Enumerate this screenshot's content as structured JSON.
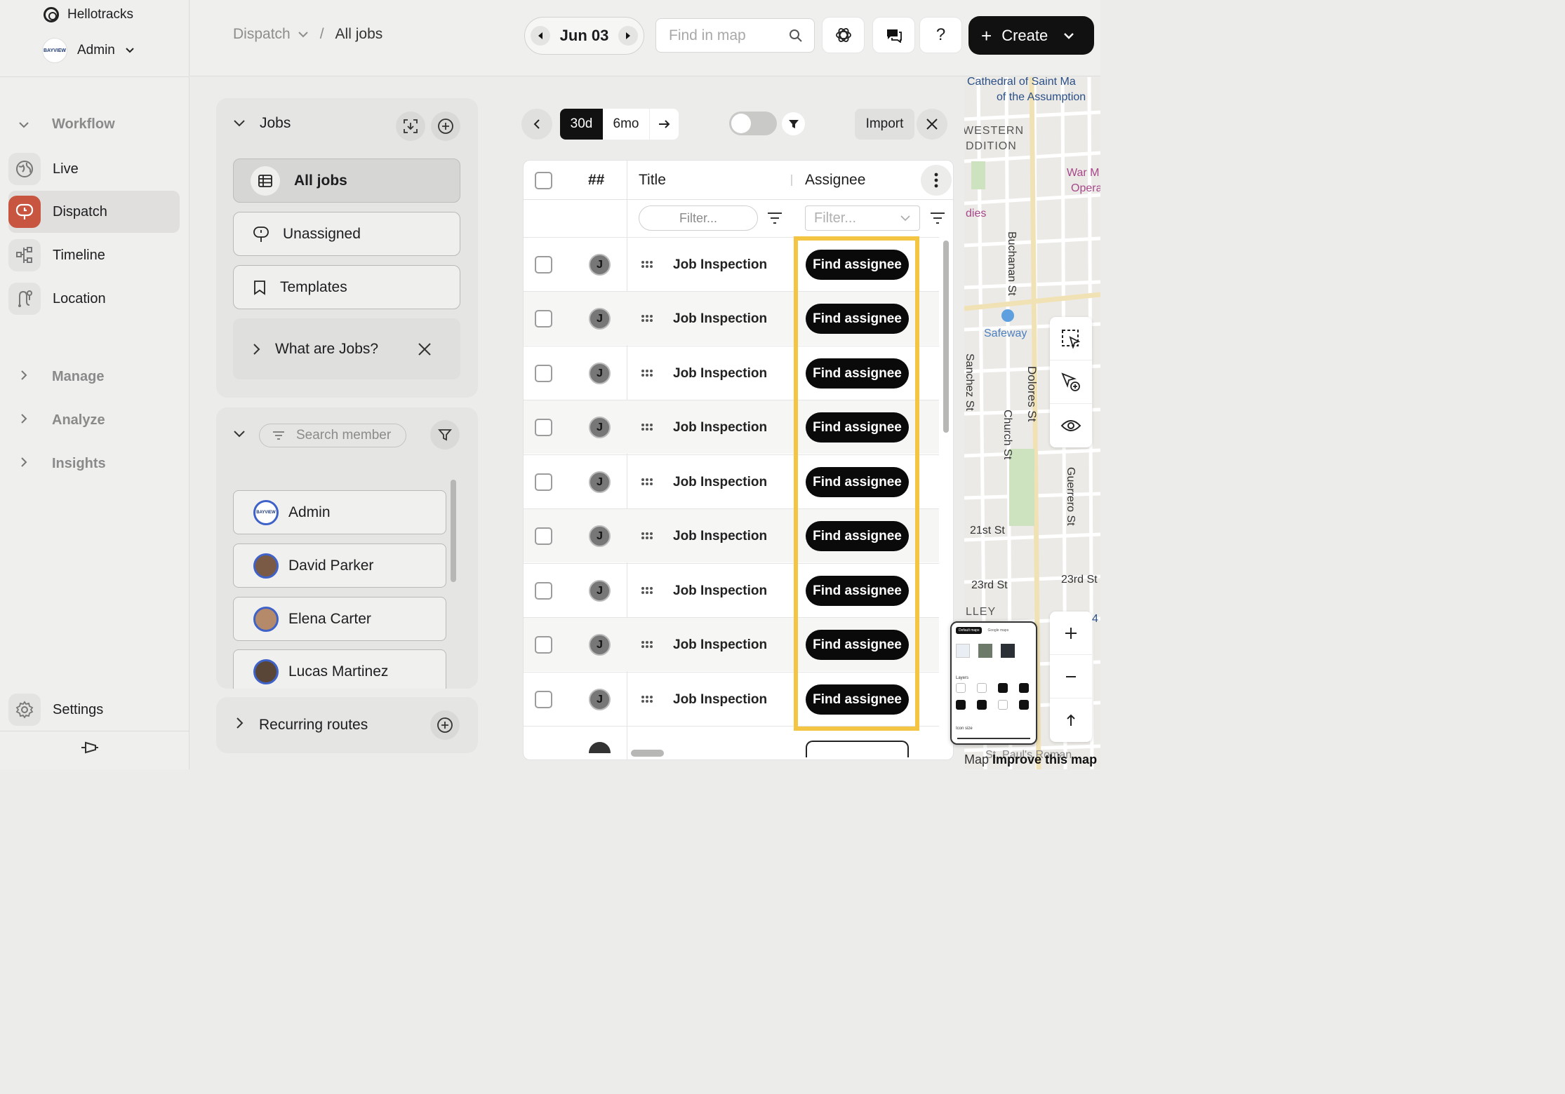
{
  "sidebar": {
    "org_name": "Hellotracks",
    "account_name": "Admin",
    "avatar_text": "BAYVIEW",
    "sections": {
      "workflow": "Workflow",
      "manage": "Manage",
      "analyze": "Analyze",
      "insights": "Insights"
    },
    "items": [
      {
        "label": "Live",
        "icon": "globe-icon"
      },
      {
        "label": "Dispatch",
        "icon": "dispatch-icon",
        "active": true
      },
      {
        "label": "Timeline",
        "icon": "timeline-icon"
      },
      {
        "label": "Location",
        "icon": "route-icon"
      }
    ],
    "settings_label": "Settings"
  },
  "header": {
    "breadcrumb_parent": "Dispatch",
    "breadcrumb_separator": "/",
    "breadcrumb_current": "All jobs",
    "date": "Jun 03",
    "map_search_placeholder": "Find in map",
    "help_label": "?",
    "create_label": "Create"
  },
  "jobs_panel": {
    "title": "Jobs",
    "items": [
      "All jobs",
      "Unassigned",
      "Templates"
    ],
    "info_label": "What are Jobs?"
  },
  "members_panel": {
    "search_placeholder": "Search member",
    "members": [
      {
        "name": "Admin"
      },
      {
        "name": "David Parker"
      },
      {
        "name": "Elena Carter"
      },
      {
        "name": "Lucas Martinez"
      }
    ]
  },
  "recurring": {
    "label": "Recurring routes"
  },
  "toolbar": {
    "range_options": [
      "30d",
      "6mo"
    ],
    "selected_range": "30d",
    "import_label": "Import"
  },
  "table": {
    "headers": {
      "number": "##",
      "title": "Title",
      "assignee": "Assignee"
    },
    "title_filter_placeholder": "Filter...",
    "assignee_filter_placeholder": "Filter...",
    "rows": [
      {
        "badge": "J",
        "title": "Job Inspection",
        "action": "Find assignee"
      },
      {
        "badge": "J",
        "title": "Job Inspection",
        "action": "Find assignee"
      },
      {
        "badge": "J",
        "title": "Job Inspection",
        "action": "Find assignee"
      },
      {
        "badge": "J",
        "title": "Job Inspection",
        "action": "Find assignee"
      },
      {
        "badge": "J",
        "title": "Job Inspection",
        "action": "Find assignee"
      },
      {
        "badge": "J",
        "title": "Job Inspection",
        "action": "Find assignee"
      },
      {
        "badge": "J",
        "title": "Job Inspection",
        "action": "Find assignee"
      },
      {
        "badge": "J",
        "title": "Job Inspection",
        "action": "Find assignee"
      },
      {
        "badge": "J",
        "title": "Job Inspection",
        "action": "Find assignee"
      }
    ],
    "highlight_color": "#f4c542"
  },
  "map": {
    "labels": {
      "cathedral": "Cathedral of Saint Ma",
      "assumption": "of the Assumption",
      "western": "WESTERN",
      "addition": "DDITION",
      "war": "War M",
      "opera": "Opera",
      "dies": "dies",
      "buchanan": "Buchanan St",
      "safeway": "Safeway",
      "sanchez": "Sanchez St",
      "dolores": "Dolores St",
      "church": "Church St",
      "guerrero": "Guerrero St",
      "st21": "21st St",
      "st23a": "23rd St",
      "st23b": "23rd St",
      "valley": "LLEY",
      "stpaul": "St. Paul's Roman",
      "c4": "4"
    },
    "attribution_prefix": "Map",
    "attribution_link": "Improve this map",
    "layers_preview": {
      "tab_default": "Default maps",
      "tab_google": "Google maps",
      "layers_label": "Layers",
      "icon_size_label": "Icon size"
    }
  },
  "colors": {
    "accent": "#c8553f",
    "primary_button": "#111111",
    "highlight": "#f4c542"
  }
}
